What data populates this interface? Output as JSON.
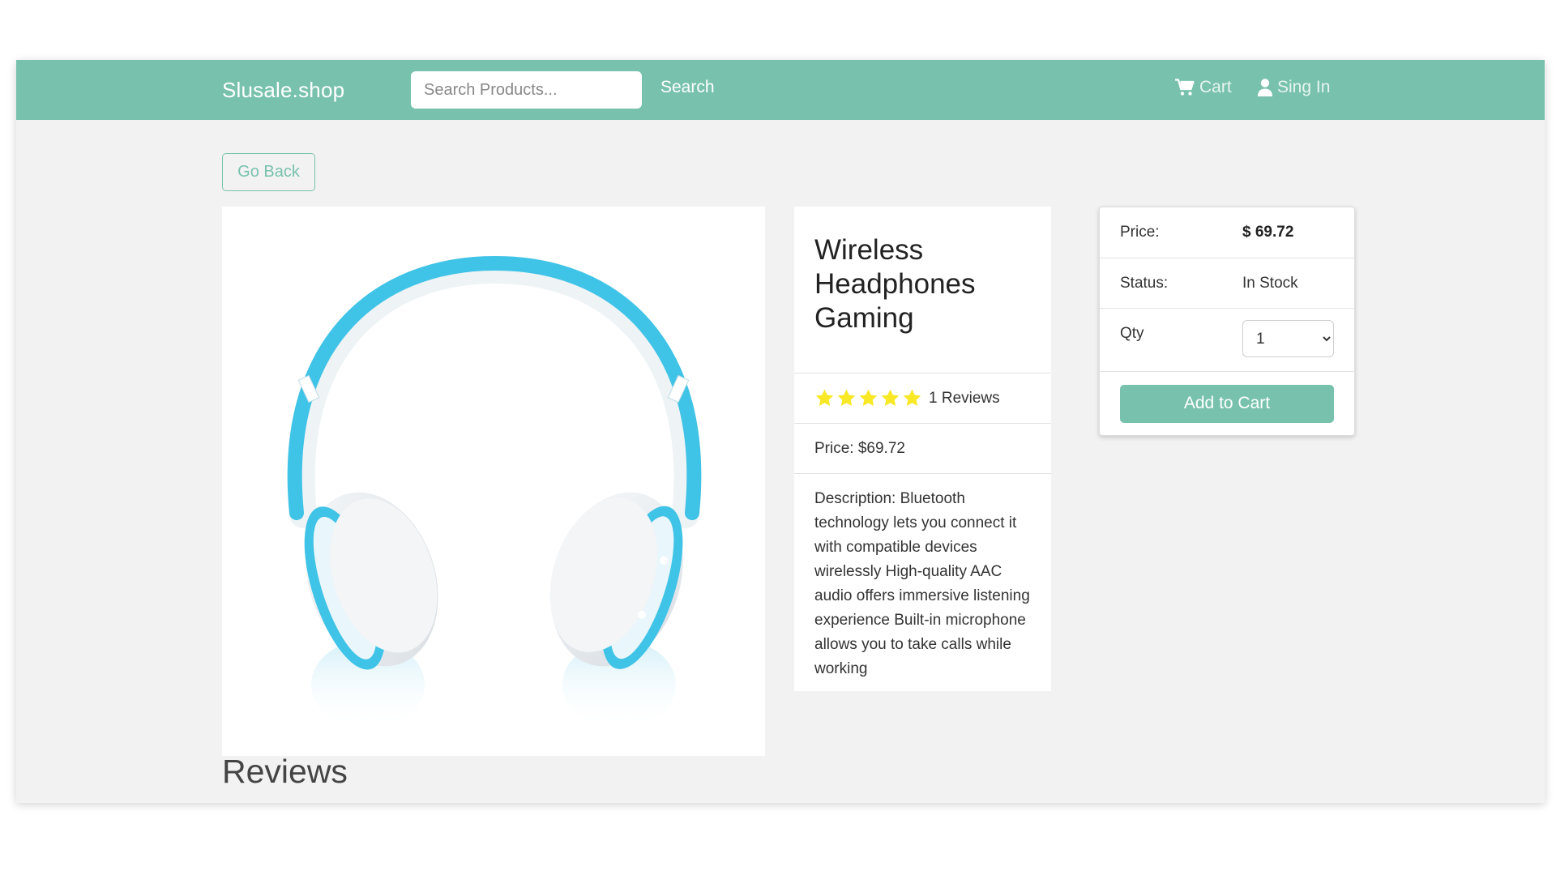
{
  "navbar": {
    "brand": "Slusale.shop",
    "search_placeholder": "Search Products...",
    "search_label": "Search",
    "cart_label": "Cart",
    "signin_label": "Sing In",
    "color": "#78c2ad"
  },
  "actions": {
    "go_back_label": "Go Back"
  },
  "product": {
    "image_alt": "headphones-image",
    "title": "Wireless Headphones Gaming",
    "rating": 5,
    "reviews_text": "1 Reviews",
    "price_text": "Price: $69.72",
    "description": "Description: Bluetooth technology lets you connect it with compatible devices wirelessly High-quality AAC audio offers immersive listening experience Built-in microphone allows you to take calls while working"
  },
  "cart_card": {
    "price_label": "Price:",
    "price_value": "$ 69.72",
    "status_label": "Status:",
    "status_value": "In Stock",
    "qty_label": "Qty",
    "qty_value": "1",
    "add_label": "Add to Cart"
  },
  "reviews": {
    "heading": "Reviews"
  },
  "colors": {
    "accent": "#78c2ad",
    "star": "#f8e825",
    "headphone_blue": "#3fc3e6"
  }
}
